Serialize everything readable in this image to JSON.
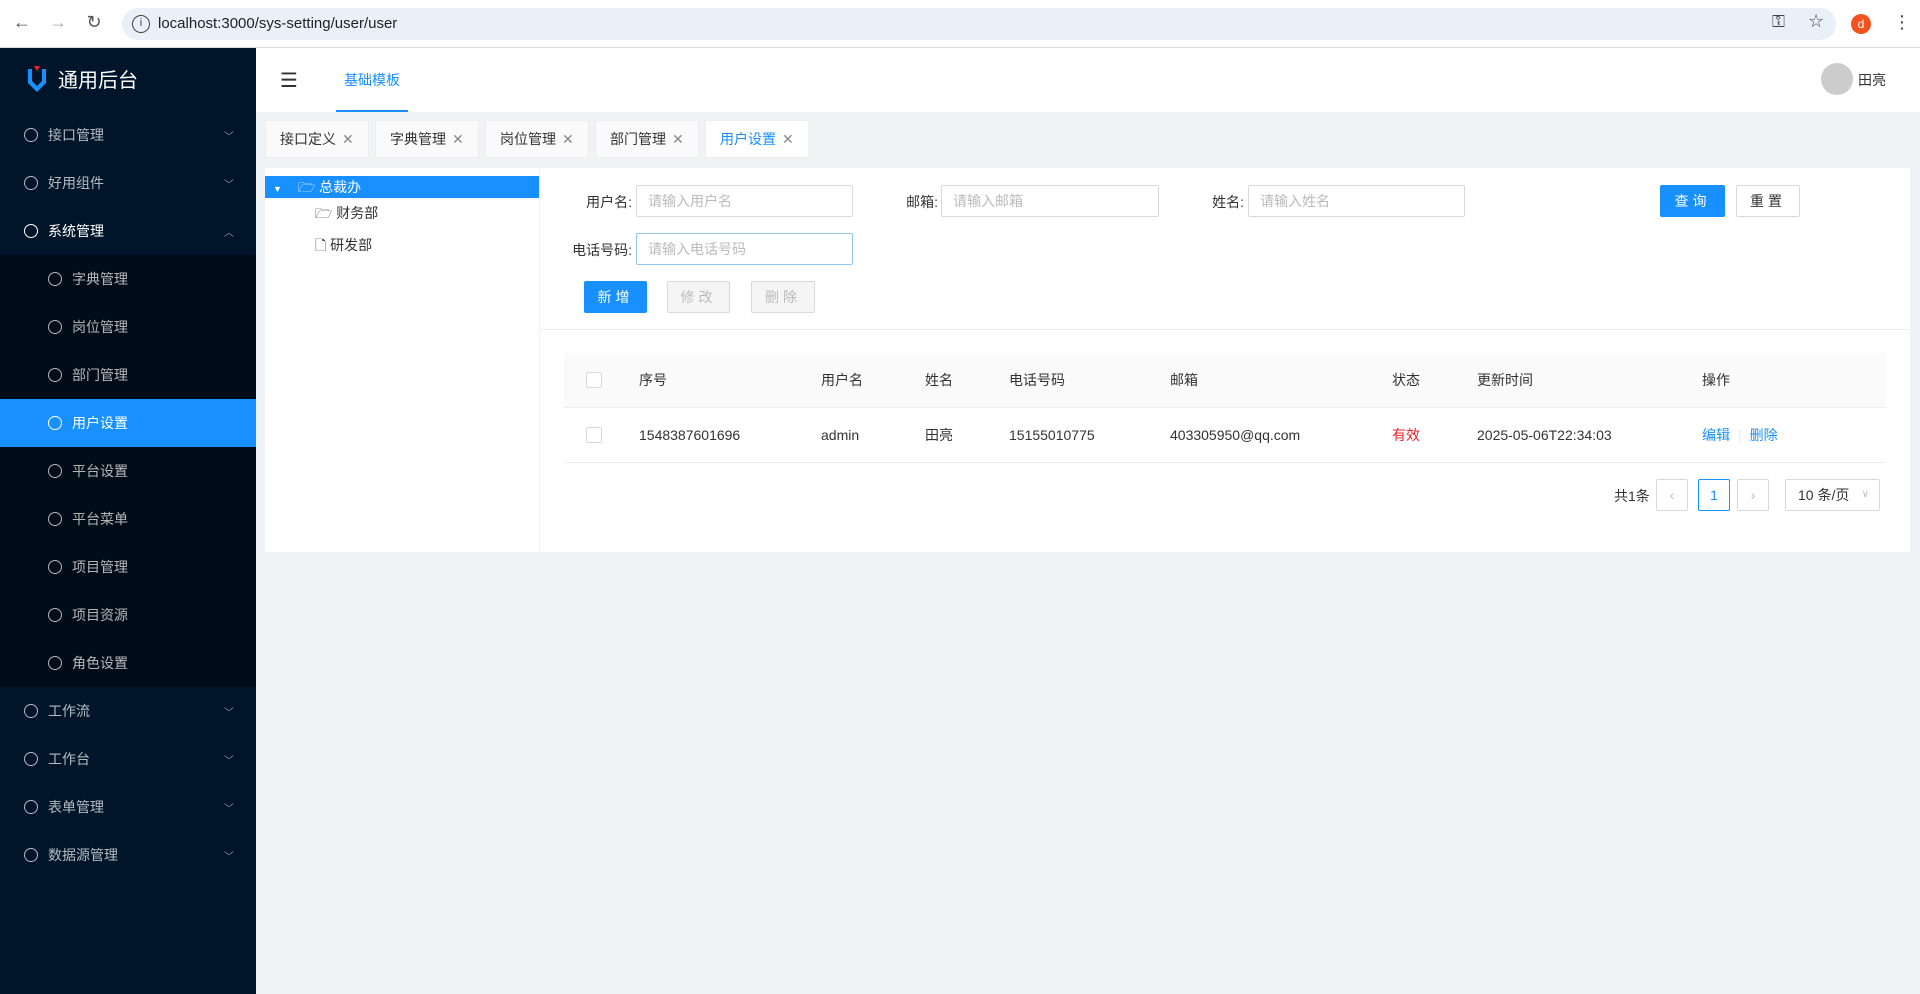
{
  "browser": {
    "url": "localhost:3000/sys-setting/user/user",
    "profile_initial": "d"
  },
  "app": {
    "title": "通用后台"
  },
  "sidebar": {
    "items": [
      {
        "label": "接口管理",
        "level": "top",
        "chevron": "down"
      },
      {
        "label": "好用组件",
        "level": "top",
        "chevron": "down"
      },
      {
        "label": "系统管理",
        "level": "top",
        "chevron": "up",
        "open": true
      },
      {
        "label": "字典管理",
        "level": "sub"
      },
      {
        "label": "岗位管理",
        "level": "sub"
      },
      {
        "label": "部门管理",
        "level": "sub"
      },
      {
        "label": "用户设置",
        "level": "sub",
        "active": true
      },
      {
        "label": "平台设置",
        "level": "sub"
      },
      {
        "label": "平台菜单",
        "level": "sub"
      },
      {
        "label": "项目管理",
        "level": "sub"
      },
      {
        "label": "项目资源",
        "level": "sub"
      },
      {
        "label": "角色设置",
        "level": "sub"
      },
      {
        "label": "工作流",
        "level": "top",
        "chevron": "down"
      },
      {
        "label": "工作台",
        "level": "top",
        "chevron": "down"
      },
      {
        "label": "表单管理",
        "level": "top",
        "chevron": "down"
      },
      {
        "label": "数据源管理",
        "level": "top",
        "chevron": "down"
      }
    ]
  },
  "header": {
    "tab": "基础模板",
    "user": "田亮"
  },
  "tabs": [
    "接口定义",
    "字典管理",
    "岗位管理",
    "部门管理",
    "用户设置"
  ],
  "tree": {
    "root": "总裁办",
    "children": [
      "财务部",
      "研发部"
    ]
  },
  "form": {
    "username_label": "用户名:",
    "username_placeholder": "请输入用户名",
    "email_label": "邮箱:",
    "email_placeholder": "请输入邮箱",
    "name_label": "姓名:",
    "name_placeholder": "请输入姓名",
    "phone_label": "电话号码:",
    "phone_placeholder": "请输入电话号码",
    "query": "查询",
    "reset": "重置",
    "add": "新增",
    "edit": "修改",
    "delete": "删除"
  },
  "table": {
    "headers": [
      "序号",
      "用户名",
      "姓名",
      "电话号码",
      "邮箱",
      "状态",
      "更新时间",
      "操作"
    ],
    "rows": [
      {
        "id": "1548387601696",
        "username": "admin",
        "name": "田亮",
        "phone": "15155010775",
        "email": "403305950@qq.com",
        "status": "有效",
        "updated": "2025-05-06T22:34:03",
        "edit": "编辑",
        "delete": "删除"
      }
    ]
  },
  "pagination": {
    "total": "共1条",
    "page": "1",
    "page_size": "10 条/页"
  },
  "colors": {
    "primary": "#1890ff",
    "sidebar": "#001529",
    "status_active": "#f5222d"
  }
}
